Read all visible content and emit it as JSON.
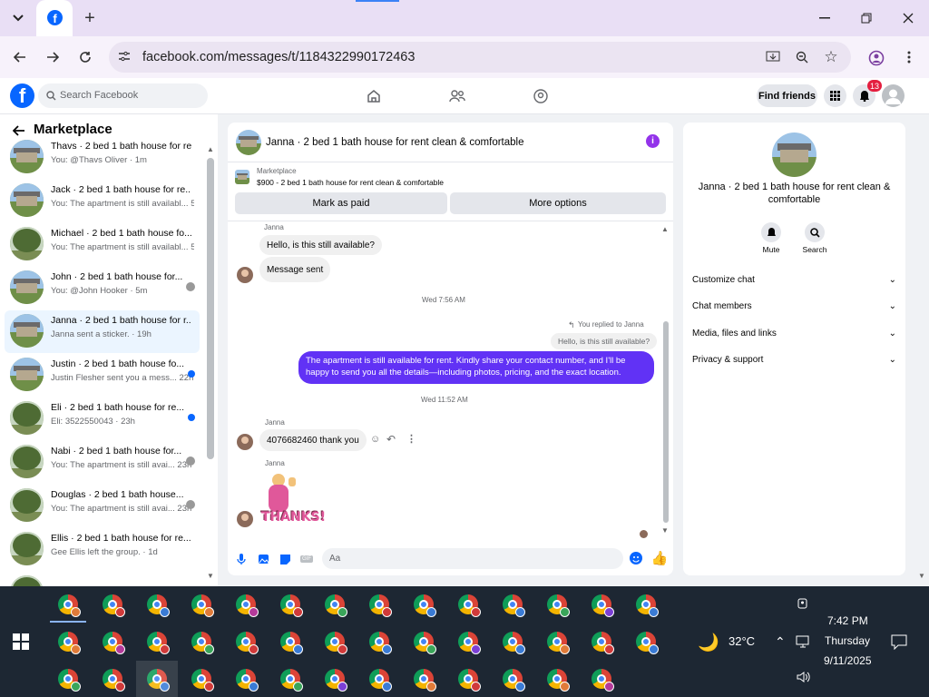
{
  "browser": {
    "url": "facebook.com/messages/t/1184322990172463"
  },
  "fb": {
    "search_placeholder": "Search Facebook",
    "find_friends": "Find friends",
    "notif_count": "13"
  },
  "left": {
    "title": "Marketplace",
    "items": [
      {
        "name": "Thavs · 2 bed 1 bath house for re...",
        "sub": "You: @Thavs Oliver · 1m",
        "thumb": "house",
        "mark": ""
      },
      {
        "name": "Jack · 2 bed 1 bath house for re...",
        "sub": "You: The apartment is still availabl... 5m",
        "thumb": "house",
        "mark": ""
      },
      {
        "name": "Michael · 2 bed 1 bath house fo...",
        "sub": "You: The apartment is still availabl... 5m",
        "thumb": "tree",
        "mark": ""
      },
      {
        "name": "John · 2 bed 1 bath house for...",
        "sub": "You: @John Hooker · 5m",
        "thumb": "house",
        "mark": "mini"
      },
      {
        "name": "Janna · 2 bed 1 bath house for r...",
        "sub": "Janna sent a sticker. · 19h",
        "thumb": "house",
        "mark": "",
        "active": true
      },
      {
        "name": "Justin · 2 bed 1 bath house fo...",
        "sub": "Justin Flesher sent you a mess... 22h",
        "thumb": "house",
        "mark": "dot"
      },
      {
        "name": "Eli · 2 bed 1 bath house for re...",
        "sub": "Eli: 3522550043 · 23h",
        "thumb": "tree",
        "mark": "dot"
      },
      {
        "name": "Nabi · 2 bed 1 bath house for...",
        "sub": "You: The apartment is still avai... 23h",
        "thumb": "tree",
        "mark": "mini"
      },
      {
        "name": "Douglas · 2 bed 1 bath house...",
        "sub": "You: The apartment is still avai... 23h",
        "thumb": "tree",
        "mark": "mini"
      },
      {
        "name": "Ellis · 2 bed 1 bath house for re...",
        "sub": "Gee Ellis left the group. · 1d",
        "thumb": "tree",
        "mark": ""
      }
    ]
  },
  "chat": {
    "title": "Janna · 2 bed 1 bath house for rent clean & comfortable",
    "mk_label": "Marketplace",
    "mk_listing": "$900 - 2 bed 1 bath house for rent clean & comfortable",
    "mark_paid": "Mark as paid",
    "more_options": "More options",
    "sender1": "Janna",
    "msg1": "Hello, is this still available?",
    "msg2": "Message sent",
    "time1": "Wed 7:56 AM",
    "replied": "You replied to Janna",
    "quoted": "Hello, is this still available?",
    "reply": "The apartment is still available for rent. Kindly share your contact number, and I'll be happy to send you all the details—including photos, pricing, and the exact location.",
    "time2": "Wed 11:52 AM",
    "sender2": "Janna",
    "msg3": "4076682460 thank you",
    "sender3": "Janna",
    "sticker": "THANKS!",
    "composer": "Aa"
  },
  "right": {
    "name": "Janna · 2 bed 1 bath house for rent clean & comfortable",
    "mute": "Mute",
    "search": "Search",
    "sections": [
      "Customize chat",
      "Chat members",
      "Media, files and links",
      "Privacy & support"
    ]
  },
  "taskbar": {
    "weather": "32°C",
    "time": "7:42 PM",
    "day": "Thursday",
    "date": "9/11/2025"
  },
  "colors": {
    "fb_blue": "#0866ff",
    "accent_purple": "#6132f5"
  }
}
